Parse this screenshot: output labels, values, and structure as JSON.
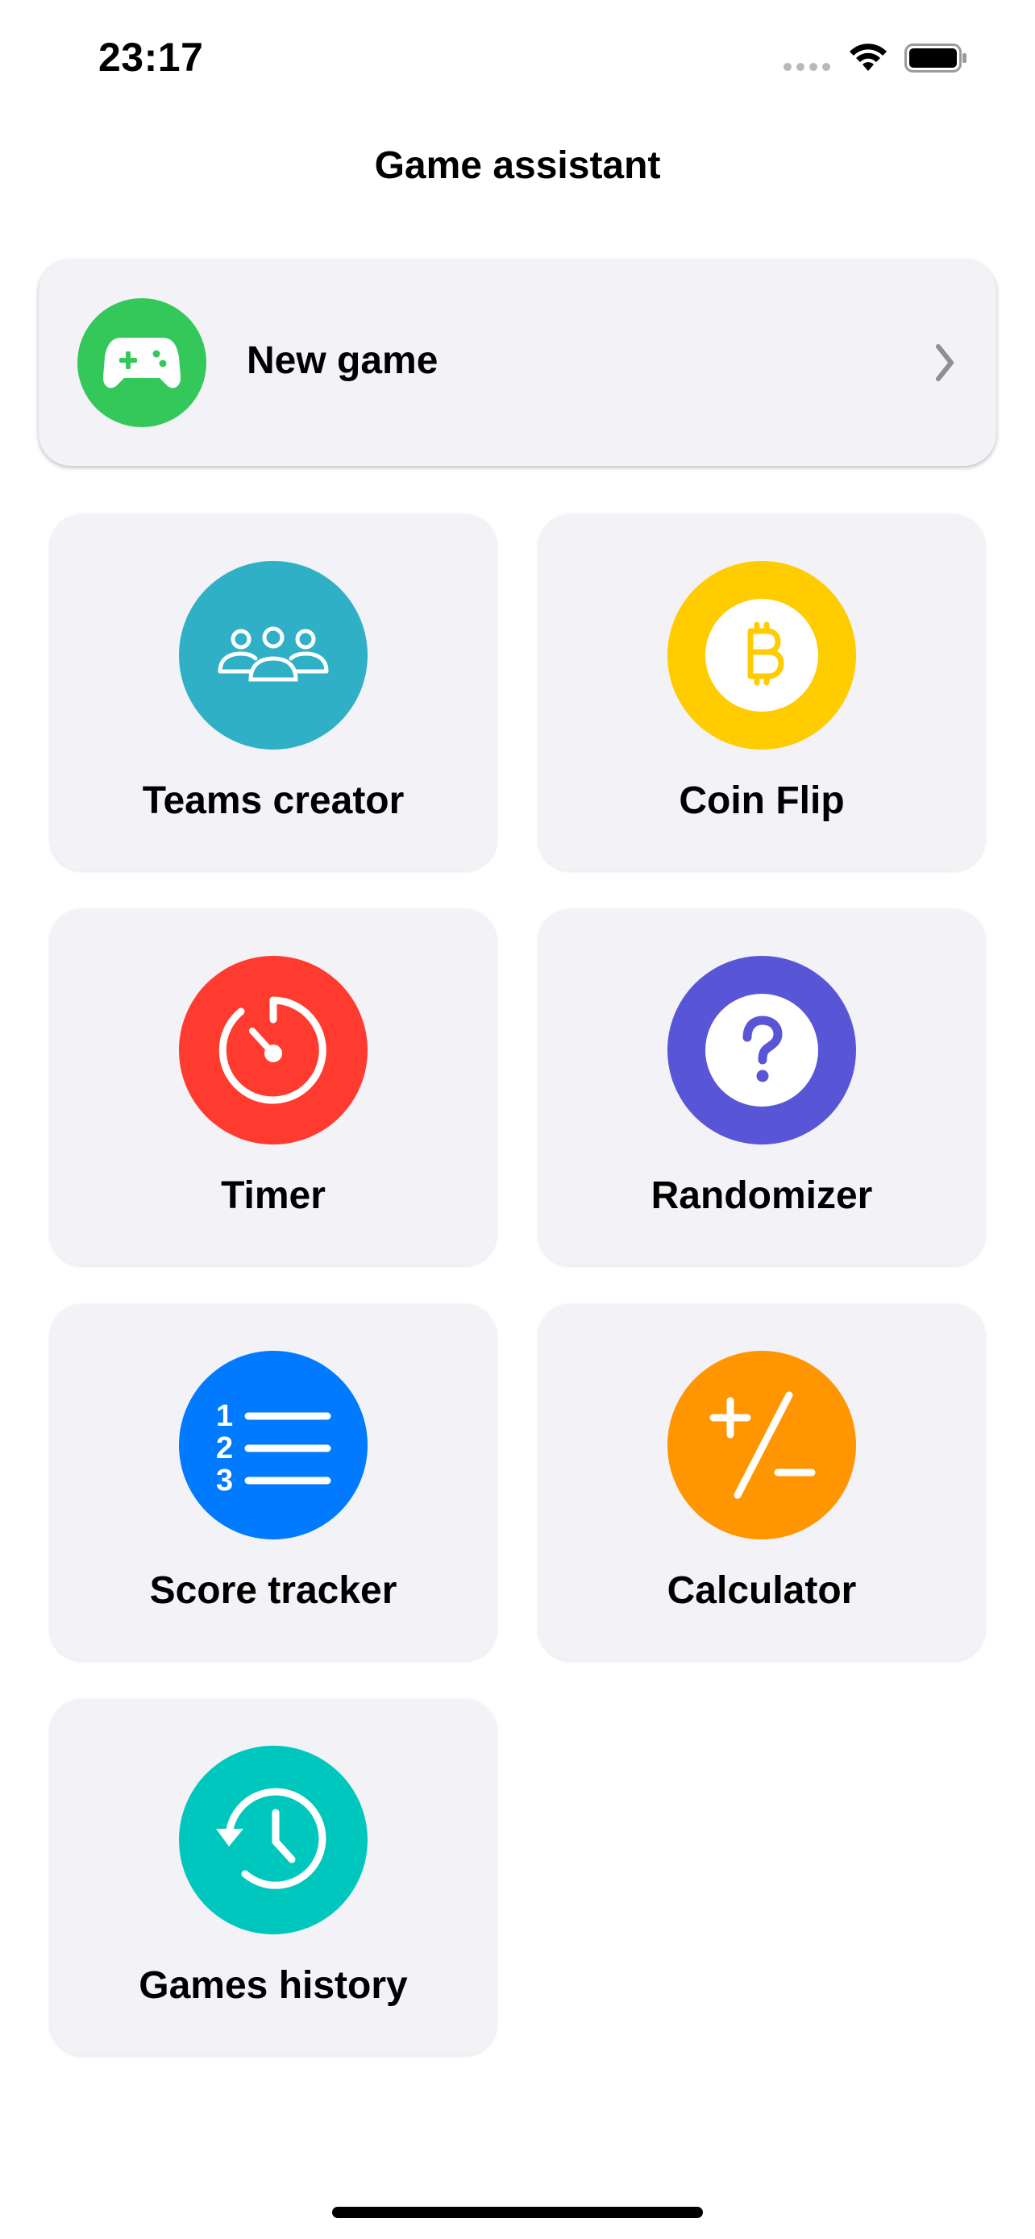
{
  "status_bar": {
    "time": "23:17"
  },
  "header": {
    "title": "Game assistant"
  },
  "new_game": {
    "label": "New game",
    "icon": "gamecontroller-icon",
    "color": "#34c759"
  },
  "tiles": [
    {
      "label": "Teams creator",
      "icon": "people-group-icon",
      "color": "#30b0c7"
    },
    {
      "label": "Coin Flip",
      "icon": "bitcoin-coin-icon",
      "color": "#ffcc00"
    },
    {
      "label": "Timer",
      "icon": "timer-icon",
      "color": "#ff3b30"
    },
    {
      "label": "Randomizer",
      "icon": "question-mark-icon",
      "color": "#5856d6"
    },
    {
      "label": "Score tracker",
      "icon": "numbered-list-icon",
      "color": "#007aff"
    },
    {
      "label": "Calculator",
      "icon": "plus-slash-minus-icon",
      "color": "#ff9500"
    },
    {
      "label": "Games history",
      "icon": "clock-history-icon",
      "color": "#00c7be"
    }
  ]
}
